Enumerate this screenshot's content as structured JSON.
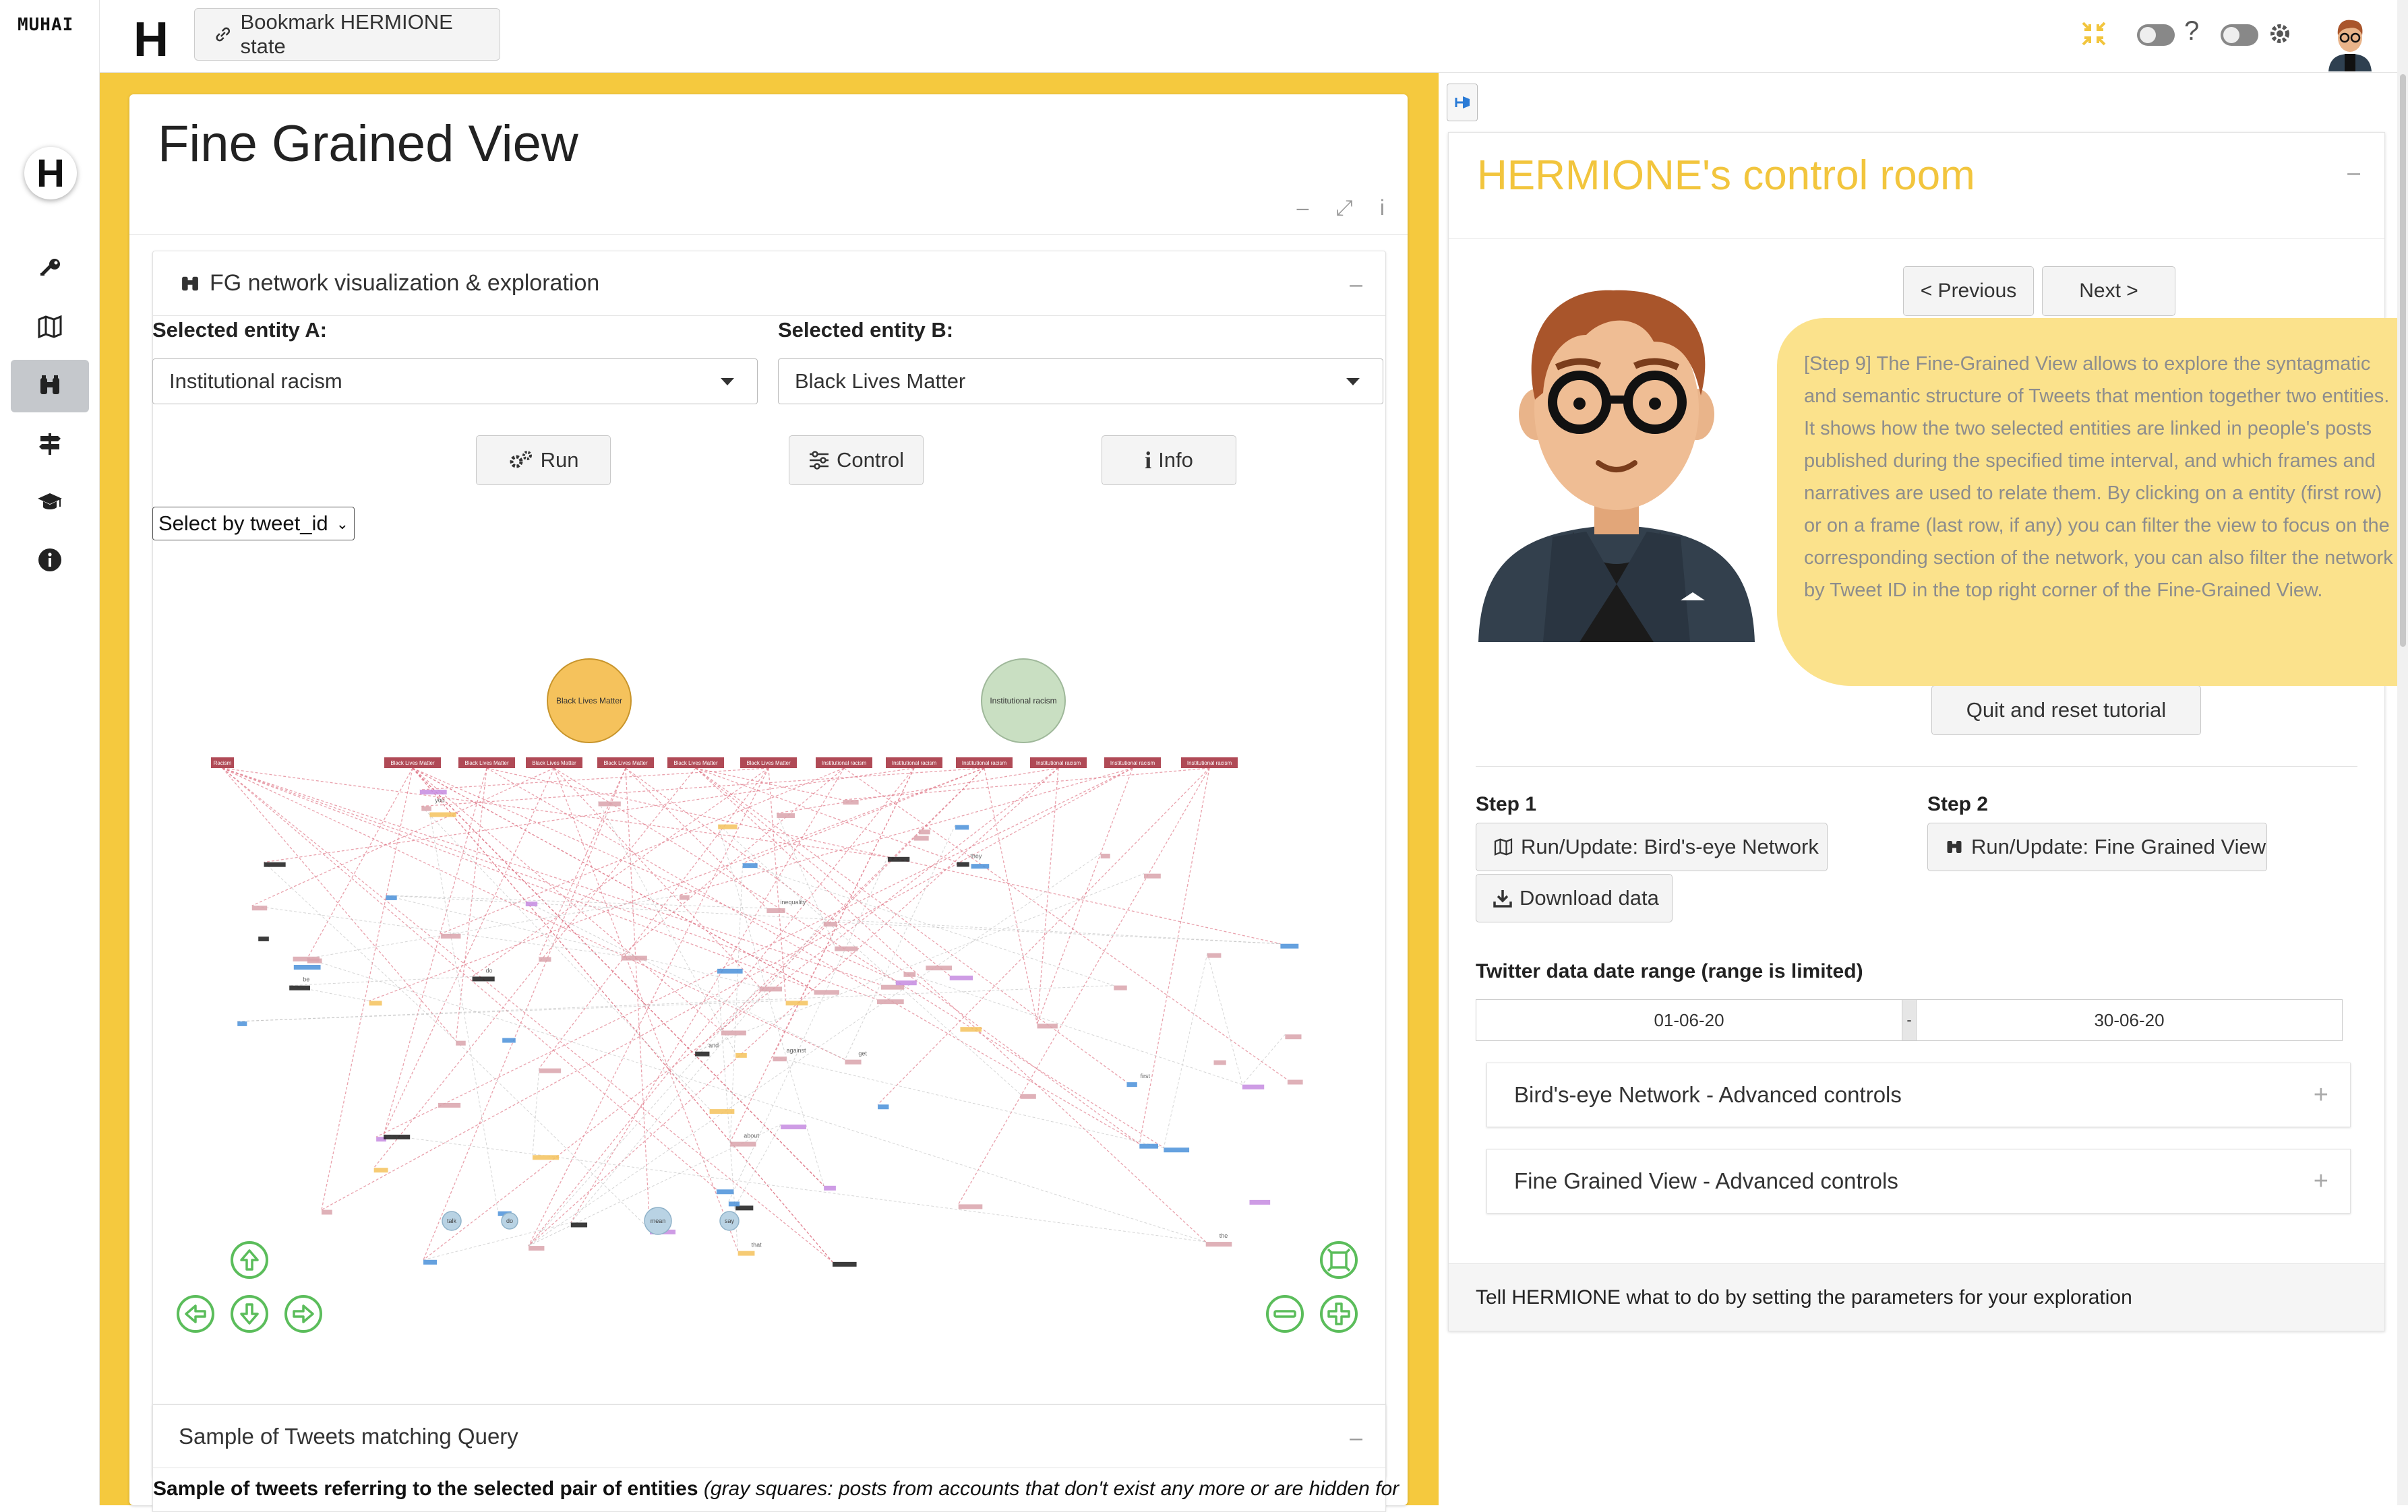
{
  "brand": "MUHAI",
  "header": {
    "logo": "H",
    "bookmark_label": "Bookmark HERMIONE state",
    "help_label": "?"
  },
  "sidebar": {
    "logo": "H",
    "items": [
      {
        "icon": "key-icon"
      },
      {
        "icon": "map-icon"
      },
      {
        "icon": "binoculars-icon",
        "active": true
      },
      {
        "icon": "signpost-icon"
      },
      {
        "icon": "graduation-cap-icon"
      },
      {
        "icon": "info-circle-icon"
      }
    ]
  },
  "fg": {
    "title": "Fine Grained View",
    "tools": [
      "–",
      "⤢",
      "i"
    ],
    "network_box": {
      "title": "FG network visualization & exploration",
      "entity_a_label": "Selected entity A:",
      "entity_a_value": "Institutional racism",
      "entity_b_label": "Selected entity B:",
      "entity_b_value": "Black Lives Matter",
      "run_label": "Run",
      "control_label": "Control",
      "info_label": "Info",
      "tweet_select": "Select by tweet_id"
    },
    "network": {
      "top_nodes": [
        {
          "label": "Black Lives Matter",
          "color": "#f5c25c"
        },
        {
          "label": "Institutional racism",
          "color": "#c9dfc2"
        }
      ],
      "row_nodes": [
        "Racism",
        "Black Lives Matter",
        "Black Lives Matter",
        "Black Lives Matter",
        "Black Lives Matter",
        "Black Lives Matter",
        "Black Lives Matter",
        "Institutional racism",
        "Institutional racism",
        "Institutional racism",
        "Institutional racism",
        "Institutional racism",
        "Institutional racism"
      ],
      "word_labels": [
        "against",
        "and",
        "be",
        "do",
        "you",
        "about",
        "that",
        "they",
        "inequality",
        "the",
        "get",
        "first"
      ],
      "frame_nodes": [
        "talk",
        "do",
        "mean",
        "say"
      ]
    },
    "tweets_box": {
      "title": "Sample of Tweets matching Query",
      "desc_bold": "Sample of tweets referring to the selected pair of entities",
      "desc_italic": "(gray squares: posts from accounts that don't exist any more or are hidden for"
    }
  },
  "control_room": {
    "title": "HERMIONE's control room",
    "prev_label": "< Previous",
    "next_label": "Next >",
    "tutorial_text": "[Step 9] The Fine-Grained View allows to explore the syntagmatic and semantic structure of Tweets that mention together two entities. It shows how the two selected entities are linked in people's posts published during the specified time interval, and which frames and narratives are used to relate them. By clicking on a entity (first row) or on a frame (last row, if any) you can filter the view to focus on the corresponding section of the network, you can also filter the network by Tweet ID in the top right corner of the Fine-Grained View.",
    "quit_label": "Quit and reset tutorial",
    "step1_label": "Step 1",
    "step1_button": "Run/Update: Bird's-eye Network",
    "download_label": "Download data",
    "step2_label": "Step 2",
    "step2_button": "Run/Update: Fine Grained View",
    "date_range_label": "Twitter data date range (range is limited)",
    "date_start": "01-06-20",
    "date_sep": "-",
    "date_end": "30-06-20",
    "birds_eye_adv": "Bird's-eye Network - Advanced controls",
    "fg_adv": "Fine Grained View - Advanced controls",
    "footer_text": "Tell HERMIONE what to do by setting the parameters for your exploration"
  },
  "colors": {
    "accent_yellow": "#f5c93e",
    "title_yellow": "#f2c53d",
    "bubble_yellow": "#fbe28c",
    "nav_green": "#5bbd5b",
    "node_red": "#b04a56"
  }
}
